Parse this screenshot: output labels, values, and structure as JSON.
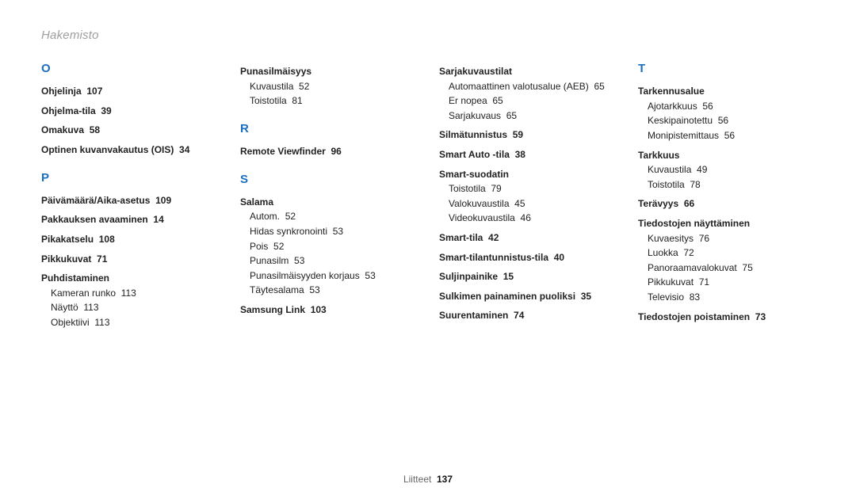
{
  "header": {
    "title": "Hakemisto"
  },
  "footer": {
    "section": "Liitteet",
    "page": "137"
  },
  "cols": [
    {
      "letters": [
        {
          "letter": "O",
          "items": [
            {
              "hdr": "Ohjelinja",
              "pg": "107"
            },
            {
              "hdr": "Ohjelma-tila",
              "pg": "39"
            },
            {
              "hdr": "Omakuva",
              "pg": "58"
            },
            {
              "hdr": "Optinen kuvanvakautus (OIS)",
              "pg": "34"
            }
          ]
        },
        {
          "letter": "P",
          "items": [
            {
              "hdr": "Päivämäärä/Aika-asetus",
              "pg": "109"
            },
            {
              "hdr": "Pakkauksen avaaminen",
              "pg": "14"
            },
            {
              "hdr": "Pikakatselu",
              "pg": "108"
            },
            {
              "hdr": "Pikkukuvat",
              "pg": "71"
            },
            {
              "hdr": "Puhdistaminen",
              "subs": [
                {
                  "t": "Kameran runko",
                  "pg": "113"
                },
                {
                  "t": "Näyttö",
                  "pg": "113"
                },
                {
                  "t": "Objektiivi",
                  "pg": "113"
                }
              ]
            }
          ]
        }
      ]
    },
    {
      "letters": [
        {
          "cont": true,
          "items": [
            {
              "hdr": "Punasilmäisyys",
              "subs": [
                {
                  "t": "Kuvaustila",
                  "pg": "52"
                },
                {
                  "t": "Toistotila",
                  "pg": "81"
                }
              ]
            }
          ]
        },
        {
          "letter": "R",
          "items": [
            {
              "hdr": "Remote Viewfinder",
              "pg": "96"
            }
          ]
        },
        {
          "letter": "S",
          "items": [
            {
              "hdr": "Salama",
              "subs": [
                {
                  "t": "Autom.",
                  "pg": "52"
                },
                {
                  "t": "Hidas synkronointi",
                  "pg": "53"
                },
                {
                  "t": "Pois",
                  "pg": "52"
                },
                {
                  "t": "Punasilm",
                  "pg": "53"
                },
                {
                  "t": "Punasilmäisyyden korjaus",
                  "pg": "53"
                },
                {
                  "t": "Täytesalama",
                  "pg": "53"
                }
              ]
            },
            {
              "hdr": "Samsung Link",
              "pg": "103"
            }
          ]
        }
      ]
    },
    {
      "letters": [
        {
          "cont": true,
          "items": [
            {
              "hdr": "Sarjakuvaustilat",
              "subs": [
                {
                  "t": "Automaattinen valotusalue (AEB)",
                  "pg": "65"
                },
                {
                  "t": "Er nopea",
                  "pg": "65"
                },
                {
                  "t": "Sarjakuvaus",
                  "pg": "65"
                }
              ]
            },
            {
              "hdr": "Silmätunnistus",
              "pg": "59"
            },
            {
              "hdr": "Smart Auto -tila",
              "pg": "38"
            },
            {
              "hdr": "Smart-suodatin",
              "subs": [
                {
                  "t": "Toistotila",
                  "pg": "79"
                },
                {
                  "t": "Valokuvaustila",
                  "pg": "45"
                },
                {
                  "t": "Videokuvaustila",
                  "pg": "46"
                }
              ]
            },
            {
              "hdr": "Smart-tila",
              "pg": "42"
            },
            {
              "hdr": "Smart-tilantunnistus-tila",
              "pg": "40"
            },
            {
              "hdr": "Suljinpainike",
              "pg": "15"
            },
            {
              "hdr": "Sulkimen painaminen puoliksi",
              "pg": "35"
            },
            {
              "hdr": "Suurentaminen",
              "pg": "74"
            }
          ]
        }
      ]
    },
    {
      "letters": [
        {
          "letter": "T",
          "items": [
            {
              "hdr": "Tarkennusalue",
              "subs": [
                {
                  "t": "Ajotarkkuus",
                  "pg": "56"
                },
                {
                  "t": "Keskipainotettu",
                  "pg": "56"
                },
                {
                  "t": "Monipistemittaus",
                  "pg": "56"
                }
              ]
            },
            {
              "hdr": "Tarkkuus",
              "subs": [
                {
                  "t": "Kuvaustila",
                  "pg": "49"
                },
                {
                  "t": "Toistotila",
                  "pg": "78"
                }
              ]
            },
            {
              "hdr": "Terävyys",
              "pg": "66"
            },
            {
              "hdr": "Tiedostojen näyttäminen",
              "subs": [
                {
                  "t": "Kuvaesitys",
                  "pg": "76"
                },
                {
                  "t": "Luokka",
                  "pg": "72"
                },
                {
                  "t": "Panoraamavalokuvat",
                  "pg": "75"
                },
                {
                  "t": "Pikkukuvat",
                  "pg": "71"
                },
                {
                  "t": "Televisio",
                  "pg": "83"
                }
              ]
            },
            {
              "hdr": "Tiedostojen poistaminen",
              "pg": "73"
            }
          ]
        }
      ]
    }
  ]
}
